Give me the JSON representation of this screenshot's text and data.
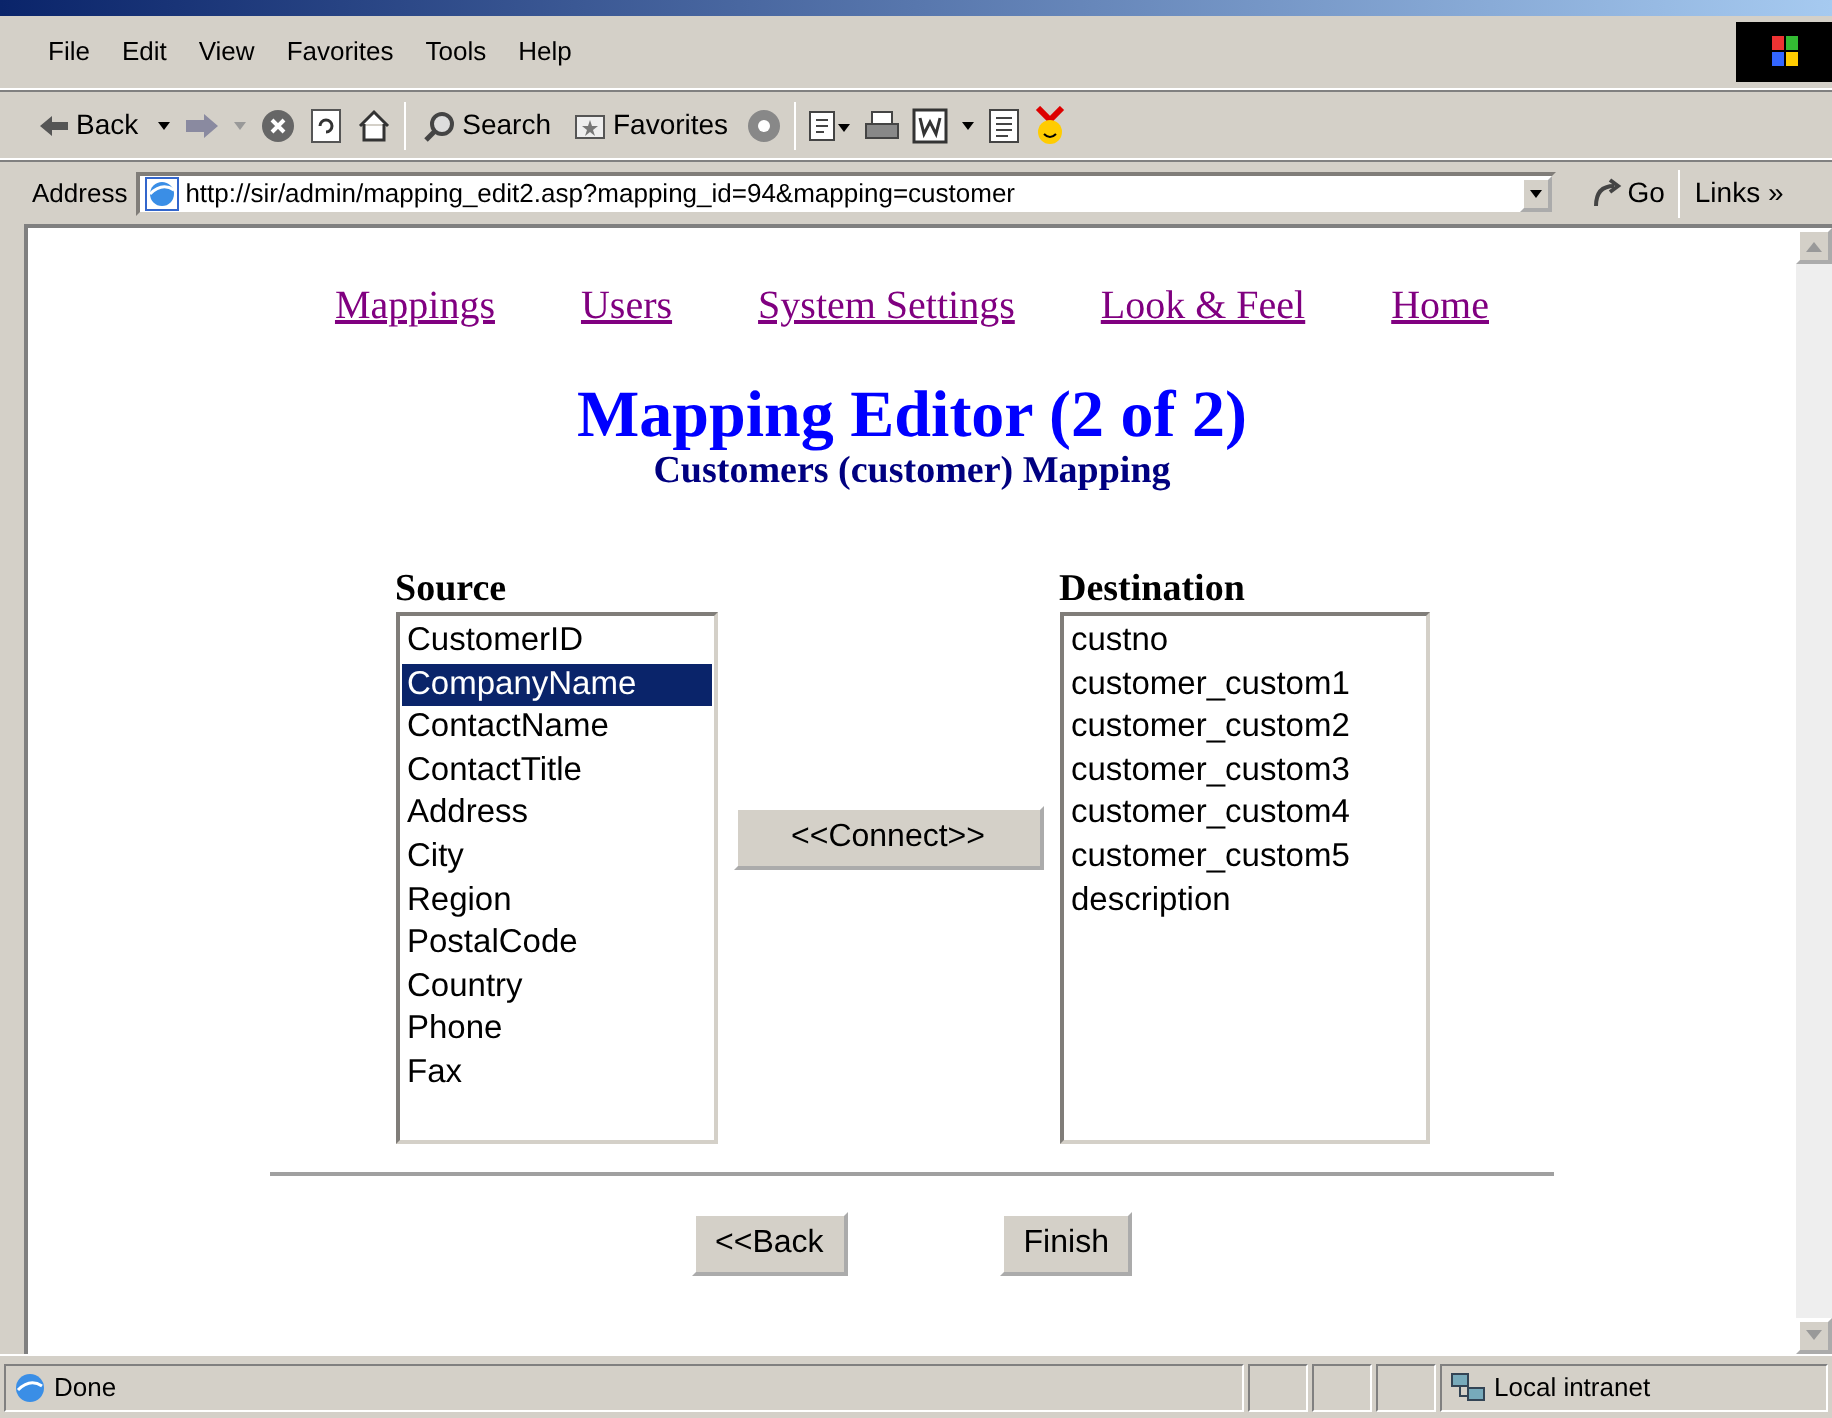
{
  "menu": [
    {
      "label": "File"
    },
    {
      "label": "Edit"
    },
    {
      "label": "View"
    },
    {
      "label": "Favorites"
    },
    {
      "label": "Tools"
    },
    {
      "label": "Help"
    }
  ],
  "toolbar": {
    "back": "Back",
    "search": "Search",
    "favorites": "Favorites"
  },
  "address": {
    "label": "Address",
    "url": "http://sir/admin/mapping_edit2.asp?mapping_id=94&mapping=customer",
    "go": "Go",
    "links": "Links »"
  },
  "nav_links": [
    {
      "label": "Mappings"
    },
    {
      "label": "Users"
    },
    {
      "label": "System Settings"
    },
    {
      "label": "Look & Feel"
    },
    {
      "label": "Home"
    }
  ],
  "title": "Mapping Editor (2 of 2)",
  "subtitle": "Customers (customer) Mapping",
  "source": {
    "label": "Source",
    "items": [
      {
        "text": "CustomerID",
        "selected": false
      },
      {
        "text": "CompanyName",
        "selected": true
      },
      {
        "text": "ContactName",
        "selected": false
      },
      {
        "text": "ContactTitle",
        "selected": false
      },
      {
        "text": "Address",
        "selected": false
      },
      {
        "text": "City",
        "selected": false
      },
      {
        "text": "Region",
        "selected": false
      },
      {
        "text": "PostalCode",
        "selected": false
      },
      {
        "text": "Country",
        "selected": false
      },
      {
        "text": "Phone",
        "selected": false
      },
      {
        "text": "Fax",
        "selected": false
      }
    ]
  },
  "connect_button": "<<Connect>>",
  "destination": {
    "label": "Destination",
    "items": [
      {
        "text": "custno",
        "selected": false
      },
      {
        "text": "customer_custom1",
        "selected": false
      },
      {
        "text": "customer_custom2",
        "selected": false
      },
      {
        "text": "customer_custom3",
        "selected": false
      },
      {
        "text": "customer_custom4",
        "selected": false
      },
      {
        "text": "customer_custom5",
        "selected": false
      },
      {
        "text": "description",
        "selected": false
      }
    ]
  },
  "buttons": [
    "<<Back",
    "Finish"
  ],
  "status": {
    "text": "Done",
    "zone": "Local intranet"
  }
}
